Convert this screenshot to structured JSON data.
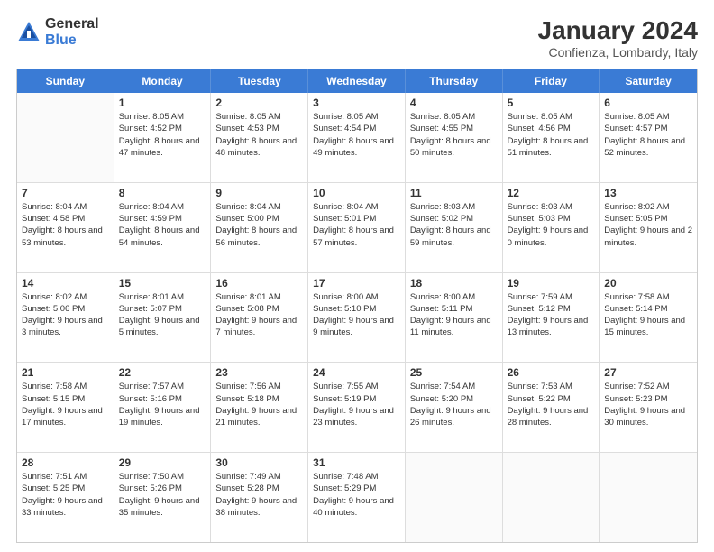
{
  "logo": {
    "general": "General",
    "blue": "Blue"
  },
  "title": "January 2024",
  "subtitle": "Confienza, Lombardy, Italy",
  "headers": [
    "Sunday",
    "Monday",
    "Tuesday",
    "Wednesday",
    "Thursday",
    "Friday",
    "Saturday"
  ],
  "weeks": [
    [
      {
        "day": "",
        "sunrise": "",
        "sunset": "",
        "daylight": "",
        "empty": true
      },
      {
        "day": "1",
        "sunrise": "Sunrise: 8:05 AM",
        "sunset": "Sunset: 4:52 PM",
        "daylight": "Daylight: 8 hours and 47 minutes."
      },
      {
        "day": "2",
        "sunrise": "Sunrise: 8:05 AM",
        "sunset": "Sunset: 4:53 PM",
        "daylight": "Daylight: 8 hours and 48 minutes."
      },
      {
        "day": "3",
        "sunrise": "Sunrise: 8:05 AM",
        "sunset": "Sunset: 4:54 PM",
        "daylight": "Daylight: 8 hours and 49 minutes."
      },
      {
        "day": "4",
        "sunrise": "Sunrise: 8:05 AM",
        "sunset": "Sunset: 4:55 PM",
        "daylight": "Daylight: 8 hours and 50 minutes."
      },
      {
        "day": "5",
        "sunrise": "Sunrise: 8:05 AM",
        "sunset": "Sunset: 4:56 PM",
        "daylight": "Daylight: 8 hours and 51 minutes."
      },
      {
        "day": "6",
        "sunrise": "Sunrise: 8:05 AM",
        "sunset": "Sunset: 4:57 PM",
        "daylight": "Daylight: 8 hours and 52 minutes."
      }
    ],
    [
      {
        "day": "7",
        "sunrise": "Sunrise: 8:04 AM",
        "sunset": "Sunset: 4:58 PM",
        "daylight": "Daylight: 8 hours and 53 minutes."
      },
      {
        "day": "8",
        "sunrise": "Sunrise: 8:04 AM",
        "sunset": "Sunset: 4:59 PM",
        "daylight": "Daylight: 8 hours and 54 minutes."
      },
      {
        "day": "9",
        "sunrise": "Sunrise: 8:04 AM",
        "sunset": "Sunset: 5:00 PM",
        "daylight": "Daylight: 8 hours and 56 minutes."
      },
      {
        "day": "10",
        "sunrise": "Sunrise: 8:04 AM",
        "sunset": "Sunset: 5:01 PM",
        "daylight": "Daylight: 8 hours and 57 minutes."
      },
      {
        "day": "11",
        "sunrise": "Sunrise: 8:03 AM",
        "sunset": "Sunset: 5:02 PM",
        "daylight": "Daylight: 8 hours and 59 minutes."
      },
      {
        "day": "12",
        "sunrise": "Sunrise: 8:03 AM",
        "sunset": "Sunset: 5:03 PM",
        "daylight": "Daylight: 9 hours and 0 minutes."
      },
      {
        "day": "13",
        "sunrise": "Sunrise: 8:02 AM",
        "sunset": "Sunset: 5:05 PM",
        "daylight": "Daylight: 9 hours and 2 minutes."
      }
    ],
    [
      {
        "day": "14",
        "sunrise": "Sunrise: 8:02 AM",
        "sunset": "Sunset: 5:06 PM",
        "daylight": "Daylight: 9 hours and 3 minutes."
      },
      {
        "day": "15",
        "sunrise": "Sunrise: 8:01 AM",
        "sunset": "Sunset: 5:07 PM",
        "daylight": "Daylight: 9 hours and 5 minutes."
      },
      {
        "day": "16",
        "sunrise": "Sunrise: 8:01 AM",
        "sunset": "Sunset: 5:08 PM",
        "daylight": "Daylight: 9 hours and 7 minutes."
      },
      {
        "day": "17",
        "sunrise": "Sunrise: 8:00 AM",
        "sunset": "Sunset: 5:10 PM",
        "daylight": "Daylight: 9 hours and 9 minutes."
      },
      {
        "day": "18",
        "sunrise": "Sunrise: 8:00 AM",
        "sunset": "Sunset: 5:11 PM",
        "daylight": "Daylight: 9 hours and 11 minutes."
      },
      {
        "day": "19",
        "sunrise": "Sunrise: 7:59 AM",
        "sunset": "Sunset: 5:12 PM",
        "daylight": "Daylight: 9 hours and 13 minutes."
      },
      {
        "day": "20",
        "sunrise": "Sunrise: 7:58 AM",
        "sunset": "Sunset: 5:14 PM",
        "daylight": "Daylight: 9 hours and 15 minutes."
      }
    ],
    [
      {
        "day": "21",
        "sunrise": "Sunrise: 7:58 AM",
        "sunset": "Sunset: 5:15 PM",
        "daylight": "Daylight: 9 hours and 17 minutes."
      },
      {
        "day": "22",
        "sunrise": "Sunrise: 7:57 AM",
        "sunset": "Sunset: 5:16 PM",
        "daylight": "Daylight: 9 hours and 19 minutes."
      },
      {
        "day": "23",
        "sunrise": "Sunrise: 7:56 AM",
        "sunset": "Sunset: 5:18 PM",
        "daylight": "Daylight: 9 hours and 21 minutes."
      },
      {
        "day": "24",
        "sunrise": "Sunrise: 7:55 AM",
        "sunset": "Sunset: 5:19 PM",
        "daylight": "Daylight: 9 hours and 23 minutes."
      },
      {
        "day": "25",
        "sunrise": "Sunrise: 7:54 AM",
        "sunset": "Sunset: 5:20 PM",
        "daylight": "Daylight: 9 hours and 26 minutes."
      },
      {
        "day": "26",
        "sunrise": "Sunrise: 7:53 AM",
        "sunset": "Sunset: 5:22 PM",
        "daylight": "Daylight: 9 hours and 28 minutes."
      },
      {
        "day": "27",
        "sunrise": "Sunrise: 7:52 AM",
        "sunset": "Sunset: 5:23 PM",
        "daylight": "Daylight: 9 hours and 30 minutes."
      }
    ],
    [
      {
        "day": "28",
        "sunrise": "Sunrise: 7:51 AM",
        "sunset": "Sunset: 5:25 PM",
        "daylight": "Daylight: 9 hours and 33 minutes."
      },
      {
        "day": "29",
        "sunrise": "Sunrise: 7:50 AM",
        "sunset": "Sunset: 5:26 PM",
        "daylight": "Daylight: 9 hours and 35 minutes."
      },
      {
        "day": "30",
        "sunrise": "Sunrise: 7:49 AM",
        "sunset": "Sunset: 5:28 PM",
        "daylight": "Daylight: 9 hours and 38 minutes."
      },
      {
        "day": "31",
        "sunrise": "Sunrise: 7:48 AM",
        "sunset": "Sunset: 5:29 PM",
        "daylight": "Daylight: 9 hours and 40 minutes."
      },
      {
        "day": "",
        "sunrise": "",
        "sunset": "",
        "daylight": "",
        "empty": true
      },
      {
        "day": "",
        "sunrise": "",
        "sunset": "",
        "daylight": "",
        "empty": true
      },
      {
        "day": "",
        "sunrise": "",
        "sunset": "",
        "daylight": "",
        "empty": true
      }
    ]
  ]
}
